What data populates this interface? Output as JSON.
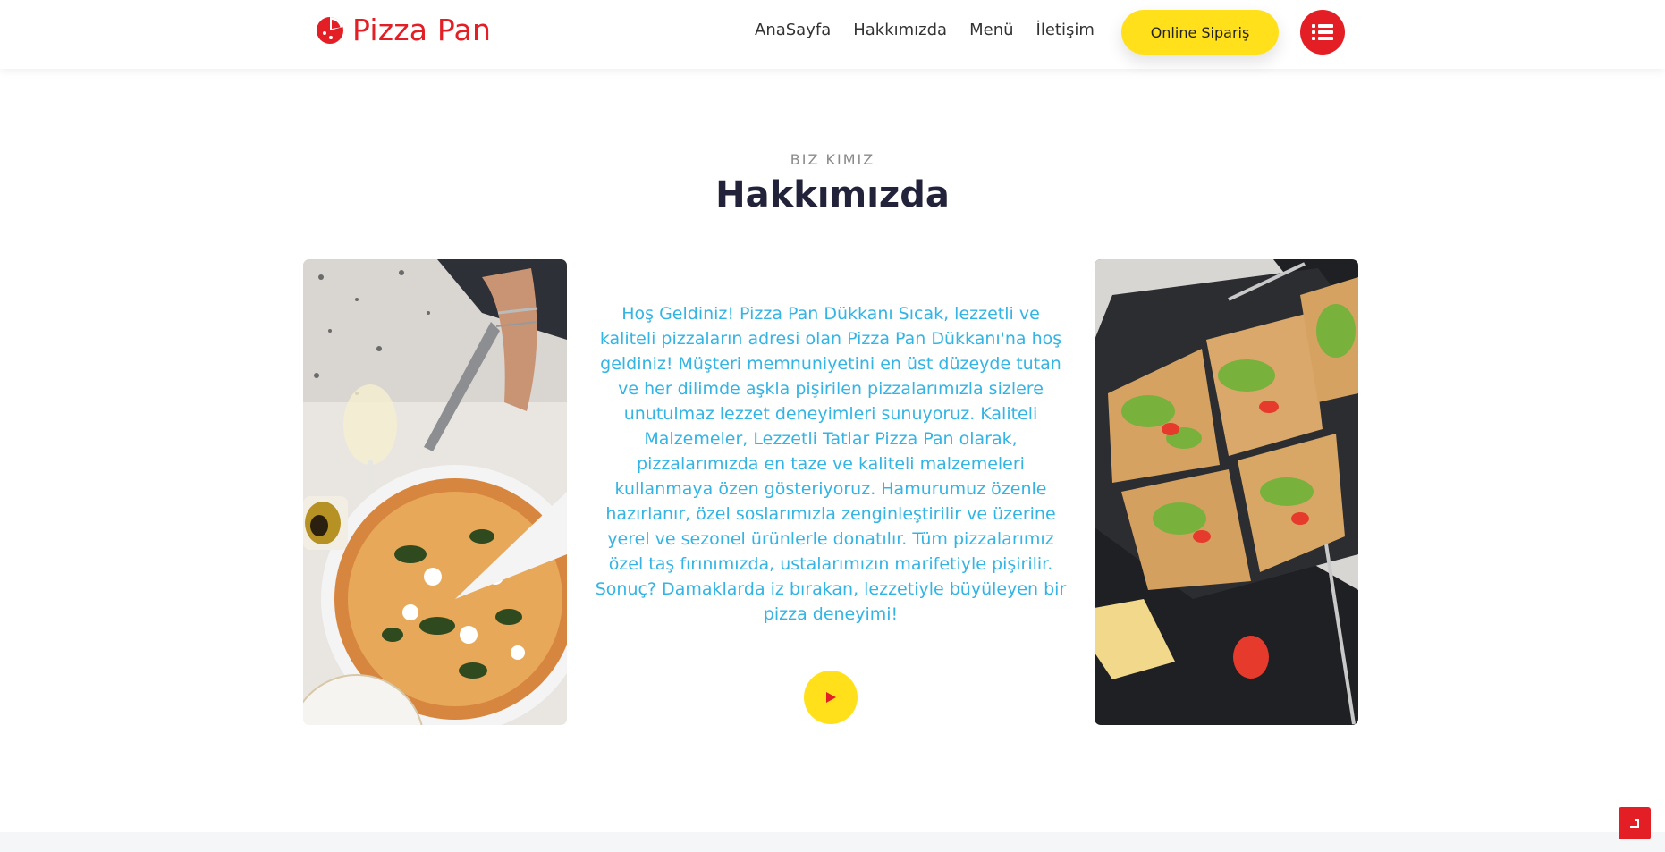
{
  "brand": {
    "name": "Pizza Pan",
    "color": "#e31e24",
    "icon": "pizza-slice-icon"
  },
  "nav": {
    "links": [
      {
        "label": "AnaSayfa"
      },
      {
        "label": "Hakkımızda"
      },
      {
        "label": "Menü"
      },
      {
        "label": "İletişim"
      }
    ],
    "order_label": "Online Sipariş",
    "order_color": "#ffe01b",
    "menu_icon": "list-icon"
  },
  "about": {
    "subtitle": "BIZ KIMIZ",
    "title": "Hakkımızda",
    "text": "Hoş Geldiniz! Pizza Pan Dükkanı Sıcak, lezzetli ve kaliteli pizzaların adresi olan Pizza Pan Dükkanı'na hoş geldiniz! Müşteri memnuniyetini en üst düzeyde tutan ve her dilimde aşkla pişirilen pizzalarımızla sizlere unutulmaz lezzet deneyimleri sunuyoruz. Kaliteli Malzemeler, Lezzetli Tatlar Pizza Pan olarak, pizzalarımızda en taze ve kaliteli malzemeleri kullanmaya özen gösteriyoruz. Hamurumuz özenle hazırlanır, özel soslarımızla zenginleştirilir ve üzerine yerel ve sezonel ürünlerle donatılır. Tüm pizzalarımız özel taş fırınımızda, ustalarımızın marifetiyle pişirilir. Sonuç? Damaklarda iz bırakan, lezzetiyle büyüleyen bir pizza deneyimi!",
    "text_color": "#33b4e4",
    "play_icon": "play-icon"
  },
  "scroll_top_icon": "arrow-up-icon"
}
